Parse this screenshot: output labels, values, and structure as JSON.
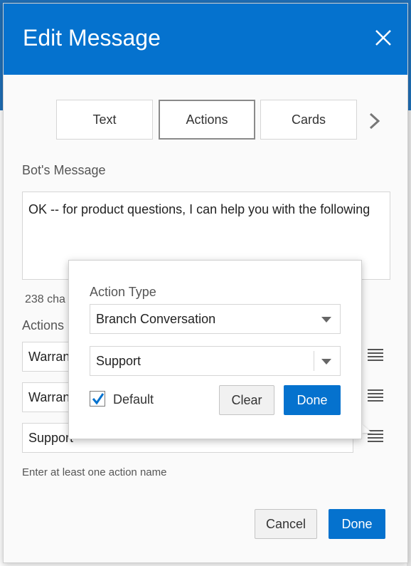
{
  "dialog": {
    "title": "Edit Message",
    "tabs": [
      {
        "label": "Text",
        "active": false
      },
      {
        "label": "Actions",
        "active": true
      },
      {
        "label": "Cards",
        "active": false
      }
    ],
    "bot_message_label": "Bot's Message",
    "bot_message_value": "OK -- for product questions, I can help you with the following",
    "char_count": "238 cha",
    "actions_label": "Actions",
    "actions": [
      {
        "value": "Warran"
      },
      {
        "value": "Warran"
      },
      {
        "value": "Support"
      }
    ],
    "hint": "Enter at least one action name",
    "cancel_label": "Cancel",
    "done_label": "Done"
  },
  "popover": {
    "action_type_label": "Action Type",
    "action_type_value": "Branch Conversation",
    "target_value": "Support",
    "default_label": "Default",
    "default_checked": true,
    "clear_label": "Clear",
    "done_label": "Done"
  },
  "colors": {
    "header": "#0572ce",
    "primary_button": "#0572ce",
    "checkbox_check": "#0572ce"
  },
  "icons": {
    "close": "close-icon",
    "next": "chevron-right-icon",
    "drag": "hamburger-icon",
    "caret": "caret-down-icon",
    "check": "checkmark-icon"
  }
}
